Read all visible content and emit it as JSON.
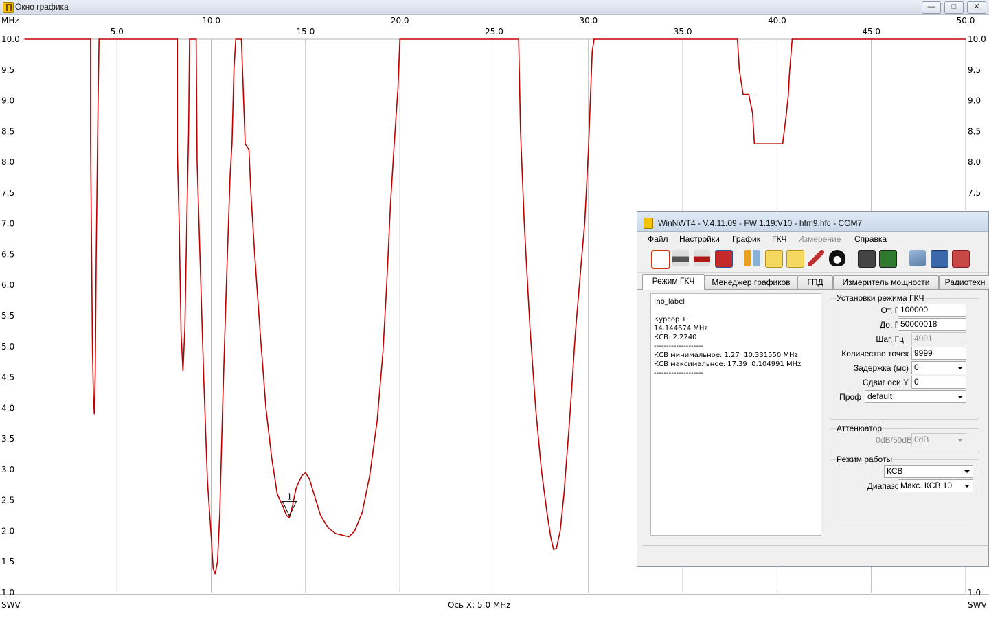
{
  "graph_window": {
    "title": "Окно графика",
    "x_unit": "MHz",
    "y_unit_left": "SWV",
    "y_unit_right": "SWV",
    "x_axis_caption": "Ось X: 5.0 MHz",
    "marker_label": "1",
    "colors": {
      "curve": "#c00000",
      "grid": "#b4b4b4",
      "axis": "#000000",
      "marker": "#000000"
    }
  },
  "chart_data": {
    "type": "line",
    "xlim": [
      0,
      50
    ],
    "ylim": [
      1.0,
      10.0
    ],
    "x_ticks": [
      "5.0",
      "10.0",
      "15.0",
      "20.0",
      "25.0",
      "30.0",
      "35.0",
      "40.0",
      "45.0"
    ],
    "x_end_labels": [
      "50.0"
    ],
    "y_ticks": [
      "10.0",
      "9.5",
      "9.0",
      "8.5",
      "8.0",
      "7.5",
      "7.0",
      "6.5",
      "6.0",
      "5.5",
      "5.0",
      "4.5",
      "4.0",
      "3.5",
      "3.0",
      "2.5",
      "2.0",
      "1.5",
      "1.0"
    ],
    "grid": true,
    "series": [
      {
        "color": "#c00000",
        "x": [
          0.1,
          3.6,
          3.6,
          3.7,
          3.75,
          3.8,
          3.85,
          3.9,
          4.0,
          4.05,
          4.1,
          4.2,
          8.2,
          8.2,
          8.3,
          8.4,
          8.5,
          8.6,
          8.7,
          8.8,
          8.85,
          9.0,
          9.2,
          9.25,
          9.4,
          9.6,
          9.8,
          10.0,
          10.1,
          10.2,
          10.33,
          10.45,
          10.6,
          10.8,
          11.0,
          11.1,
          11.2,
          11.3,
          11.35,
          11.6,
          11.8,
          12.0,
          12.1,
          12.3,
          12.6,
          12.9,
          13.2,
          13.5,
          13.8,
          14.0,
          14.14,
          14.3,
          14.5,
          14.8,
          15.0,
          15.2,
          15.5,
          15.8,
          16.2,
          16.6,
          17.0,
          17.3,
          17.6,
          18.0,
          18.4,
          18.8,
          19.1,
          19.3,
          19.5,
          19.7,
          19.9,
          20.0,
          20.1,
          26.3,
          26.4,
          26.6,
          26.9,
          27.2,
          27.5,
          27.8,
          28.0,
          28.15,
          28.3,
          28.5,
          28.7,
          29.0,
          29.3,
          29.6,
          29.8,
          30.0,
          30.1,
          30.2,
          30.3,
          30.4,
          37.9,
          38.0,
          38.2,
          38.3,
          38.5,
          38.7,
          38.8,
          38.9,
          39.0,
          39.2,
          39.5,
          39.8,
          40.0,
          40.2,
          40.3,
          40.5,
          40.6,
          40.65,
          40.8,
          50.0
        ],
        "y": [
          10.0,
          10.0,
          8.3,
          5.0,
          4.2,
          3.9,
          4.6,
          6.5,
          9.0,
          10.0,
          10.0,
          10.0,
          10.0,
          8.2,
          7.0,
          5.2,
          4.6,
          5.3,
          7.0,
          8.5,
          10.0,
          10.0,
          10.0,
          8.0,
          6.5,
          4.5,
          2.8,
          1.9,
          1.4,
          1.3,
          1.5,
          2.3,
          4.0,
          6.0,
          7.8,
          8.3,
          9.5,
          10.0,
          10.0,
          10.0,
          8.3,
          8.2,
          7.5,
          6.5,
          5.2,
          4.0,
          3.2,
          2.6,
          2.4,
          2.25,
          2.22,
          2.4,
          2.7,
          2.9,
          2.95,
          2.85,
          2.55,
          2.25,
          2.05,
          1.96,
          1.93,
          1.91,
          2.0,
          2.3,
          2.9,
          3.8,
          4.9,
          6.0,
          7.3,
          8.3,
          9.2,
          10.0,
          10.0,
          10.0,
          8.5,
          7.0,
          5.3,
          4.0,
          3.0,
          2.3,
          1.9,
          1.7,
          1.72,
          2.0,
          2.6,
          3.8,
          5.2,
          6.3,
          7.0,
          8.2,
          9.0,
          9.8,
          10.0,
          10.0,
          10.0,
          9.5,
          9.1,
          9.1,
          9.1,
          8.8,
          8.3,
          8.3,
          8.3,
          8.3,
          8.3,
          8.3,
          8.3,
          8.3,
          8.3,
          8.8,
          9.1,
          9.4,
          10.0,
          10.0
        ]
      }
    ],
    "marker": {
      "label": "1",
      "x": 14.144674,
      "y": 2.224
    }
  },
  "nwt_window": {
    "title": "WinNWT4 - V.4.11.09 - FW:1.19:V10 - hfm9.hfc - COM7",
    "menu": [
      "Файл",
      "Настройки",
      "График",
      "ГКЧ",
      "Измерение",
      "Справка"
    ],
    "menu_disabled_index": 4,
    "toolbar_icons": [
      "power-icon",
      "print-icon",
      "print-color-icon",
      "png-bmp-icon",
      "tools-icon",
      "chart-icon",
      "chart-grid-icon",
      "probe-icon",
      "linux-penguin-icon",
      "calibrate-k1-icon",
      "calibrate-k2-icon",
      "open-folder-icon",
      "save-icon",
      "clear-icon"
    ],
    "tabs": [
      "Режим ГКЧ",
      "Менеджер графиков",
      "ГПД",
      "Измеритель мощности",
      "Радиотехн"
    ],
    "active_tab": 0,
    "info_text": ";no_label\n\nКурсор 1:\n14.144674 MHz\nКСВ: 2.2240\n--------------------\nКСВ минимальное: 1.27  10.331550 MHz\nКСВ максимальное: 17.39  0.104991 MHz\n--------------------",
    "sweep_settings": {
      "title": "Установки режима ГКЧ",
      "from_label": "От, Гц",
      "from_value": "100000",
      "to_label": "До, Гц",
      "to_value": "50000018",
      "step_label": "Шаг, Гц",
      "step_value": "4991",
      "points_label": "Количество точек",
      "points_value": "9999",
      "delay_label": "Задержка (мс)",
      "delay_value": "0",
      "yshift_label": "Сдвиг оси Y",
      "yshift_value": "0",
      "profile_label": "Проф",
      "profile_value": "default"
    },
    "attenuator": {
      "title": "Аттенюатор",
      "label": "0dB/50dB",
      "value": "0dB"
    },
    "work_mode": {
      "title": "Режим работы",
      "mode_value": "КСВ",
      "range_label": "Диапазон",
      "range_value": "Макс. КСВ 10"
    }
  }
}
